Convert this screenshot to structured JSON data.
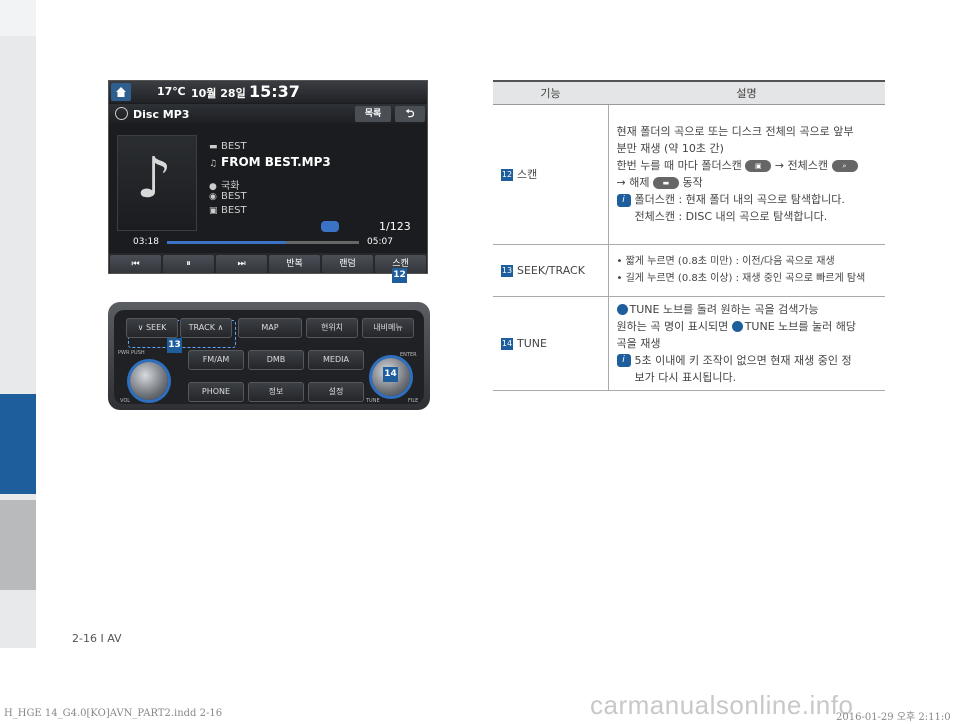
{
  "screen": {
    "temp": "17℃",
    "date": "10월 28일",
    "clock": "15:37",
    "source_title": "Disc MP3",
    "list_button": "목록",
    "back_button": "⮌",
    "album_note": "♪",
    "tracks": [
      {
        "icon": "▬",
        "text": "BEST"
      },
      {
        "icon": "♫",
        "text": "FROM BEST.MP3"
      },
      {
        "icon": "●",
        "text": "국화"
      },
      {
        "icon": "◉",
        "text": "BEST"
      },
      {
        "icon": "▣",
        "text": "BEST"
      }
    ],
    "counter": "1/123",
    "time_elapsed": "03:18",
    "time_total": "05:07",
    "progress_fraction": 0.62,
    "controls": [
      "⏮",
      "⏸",
      "⏭",
      "반복",
      "랜덤",
      "스캔"
    ]
  },
  "callouts": {
    "c12": "12",
    "c13": "13",
    "c14": "14"
  },
  "panel": {
    "seek": "∨ SEEK",
    "track": "TRACK ∧",
    "map": "MAP",
    "btn_r1c4": "현위치",
    "btn_r1c5": "내비메뉴",
    "fm_am": "FM/AM",
    "dmb": "DMB",
    "media": "MEDIA",
    "phone": "PHONE",
    "info": "정보",
    "setup": "설정",
    "pwr": "PWR PUSH",
    "vol": "VOL",
    "enter": "ENTER",
    "tune": "TUNE",
    "file": "FILE"
  },
  "table": {
    "head_fn": "기능",
    "head_desc": "설명",
    "rows": [
      {
        "num": "12",
        "fn": "스캔",
        "lines": [
          "현재 폴더의 곡으로 또는 디스크 전체의 곡으로 앞부",
          "분만 재생 (약 10초 간)",
          "한번 누를 때 마다 폴더스캔",
          "→ 전체스캔",
          "→ 해제",
          "동작",
          "폴더스캔 : 현재 폴더 내의 곡으로 탐색합니다.",
          "전체스캔 : DISC 내의 곡으로 탐색합니다."
        ]
      },
      {
        "num": "13",
        "fn": "SEEK/TRACK",
        "lines": [
          "• 짧게 누르면 (0.8초 미만) : 이전/다음 곡으로 재생",
          "• 길게 누르면 (0.8초 이상) : 재생 중인 곡으로 빠르게 탐색"
        ]
      },
      {
        "num": "14",
        "fn": "TUNE",
        "lines": [
          "TUNE 노브를 돌려 원하는 곡을 검색가능",
          "원하는 곡 명이 표시되면",
          "TUNE 노브를 눌러 해당",
          "곡을 재생",
          "5초 이내에 키 조작이 없으면 현재 재생 중인 정",
          "보가 다시 표시됩니다."
        ]
      }
    ]
  },
  "footer": {
    "page": "2-16 I AV",
    "file": "H_HGE 14_G4.0[KO]AVN_PART2.indd   2-16",
    "stamp": "2016-01-29   오후 2:11:0",
    "watermark": "carmanualsonline.info"
  }
}
